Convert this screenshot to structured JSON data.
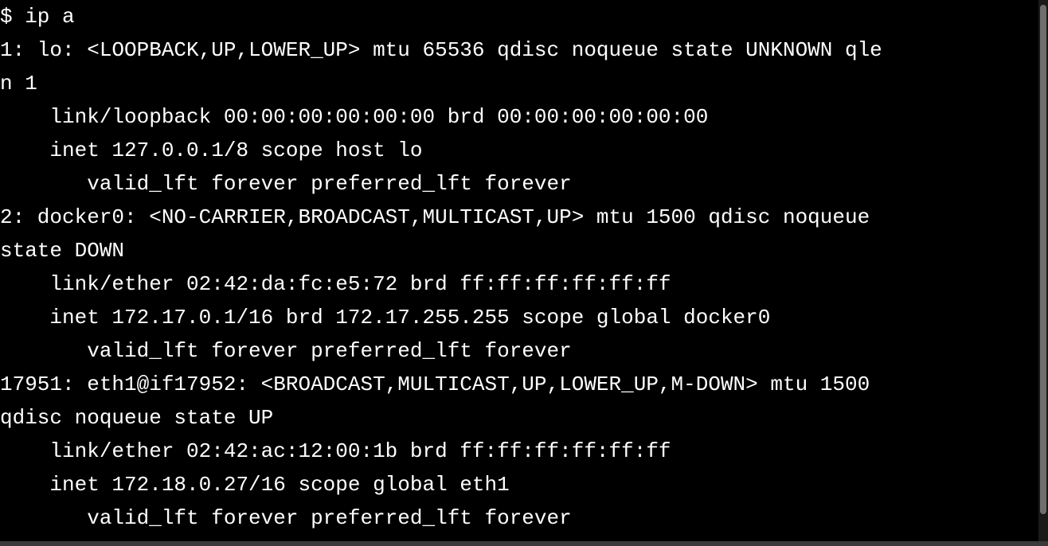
{
  "terminal": {
    "colors": {
      "background": "#000000",
      "text": "#ffffff"
    },
    "lines": [
      "$ ip a",
      "1: lo: <LOOPBACK,UP,LOWER_UP> mtu 65536 qdisc noqueue state UNKNOWN qle",
      "n 1",
      "    link/loopback 00:00:00:00:00:00 brd 00:00:00:00:00:00",
      "    inet 127.0.0.1/8 scope host lo",
      "       valid_lft forever preferred_lft forever",
      "2: docker0: <NO-CARRIER,BROADCAST,MULTICAST,UP> mtu 1500 qdisc noqueue",
      "state DOWN",
      "    link/ether 02:42:da:fc:e5:72 brd ff:ff:ff:ff:ff:ff",
      "    inet 172.17.0.1/16 brd 172.17.255.255 scope global docker0",
      "       valid_lft forever preferred_lft forever",
      "17951: eth1@if17952: <BROADCAST,MULTICAST,UP,LOWER_UP,M-DOWN> mtu 1500",
      "qdisc noqueue state UP",
      "    link/ether 02:42:ac:12:00:1b brd ff:ff:ff:ff:ff:ff",
      "    inet 172.18.0.27/16 scope global eth1",
      "       valid_lft forever preferred_lft forever"
    ]
  }
}
